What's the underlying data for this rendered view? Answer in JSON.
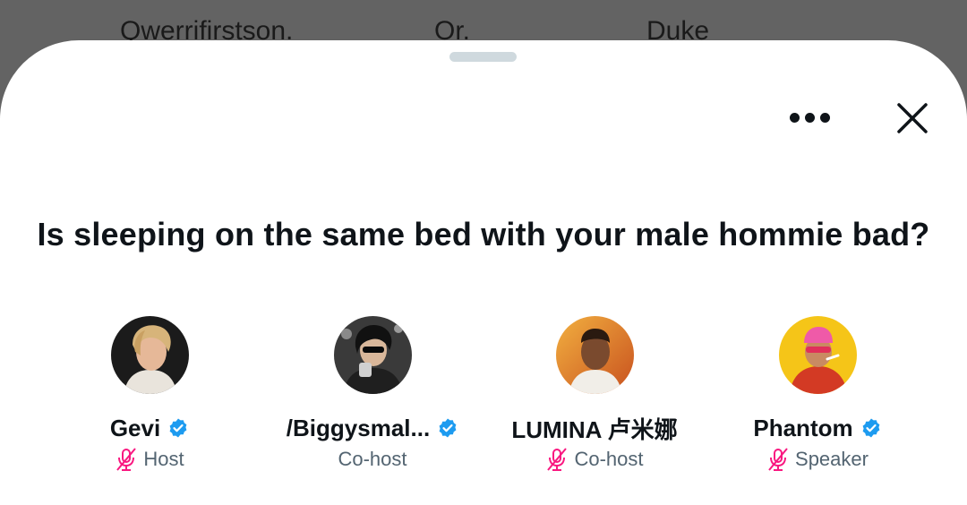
{
  "background_listeners": [
    "Qwerrifirstson.",
    "Or.",
    "Duke"
  ],
  "sheet": {
    "title": "Is sleeping on the same bed with your male hommie bad?",
    "more_icon": "more-horizontal-icon",
    "close_icon": "close-icon"
  },
  "participants": [
    {
      "name": "Gevi",
      "role": "Host",
      "verified": true,
      "muted": true
    },
    {
      "name": "/Biggysmal...",
      "role": "Co-host",
      "verified": true,
      "muted": false
    },
    {
      "name": "LUMINA 卢米娜",
      "role": "Co-host",
      "verified": false,
      "muted": true
    },
    {
      "name": "Phantom",
      "role": "Speaker",
      "verified": true,
      "muted": true
    }
  ],
  "colors": {
    "backdrop": "#636363",
    "verified_blue": "#1d9bf0",
    "muted_pink": "#f91880",
    "role_gray": "#536471",
    "text": "#0f1419"
  }
}
